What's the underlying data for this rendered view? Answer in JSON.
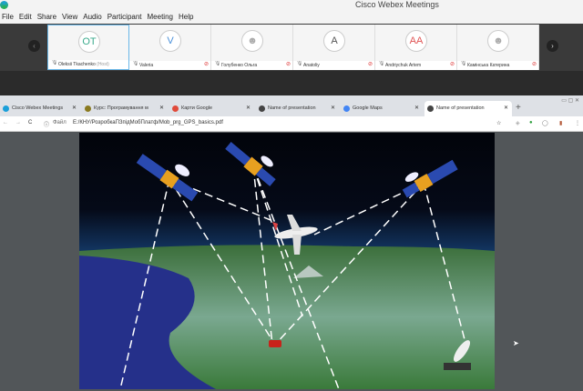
{
  "app": {
    "title": "Cisco Webex Meetings"
  },
  "menu": [
    "File",
    "Edit",
    "Share",
    "View",
    "Audio",
    "Participant",
    "Meeting",
    "Help"
  ],
  "participants": [
    {
      "initials": "OT",
      "name": "Oleksii Tkachenko",
      "role": "(Host)",
      "color": "#3aaa8c",
      "muted": false
    },
    {
      "initials": "V",
      "name": "Valeria",
      "color": "#4a90d9",
      "muted": true
    },
    {
      "initials": "",
      "name": "Голубенко Ольга",
      "color": "#aaa",
      "muted": true
    },
    {
      "initials": "A",
      "name": "Anatoliy",
      "color": "#555",
      "muted": true
    },
    {
      "initials": "AA",
      "name": "Andriychuk Artem",
      "color": "#e05555",
      "muted": true
    },
    {
      "initials": "",
      "name": "Камінська Катерина",
      "color": "#aaa",
      "muted": true
    }
  ],
  "browser": {
    "tabs": [
      {
        "label": "Cisco Webex Meetings",
        "icon_color": "#1a9fd9"
      },
      {
        "label": "Курс: Програмування м",
        "icon_color": "#8a7a20"
      },
      {
        "label": "Карти Google",
        "icon_color": "#e04a3a"
      },
      {
        "label": "Name of presentation",
        "icon_color": "#444"
      },
      {
        "label": "Google Maps",
        "icon_color": "#4285f4"
      },
      {
        "label": "Name of presentation",
        "icon_color": "#444"
      }
    ],
    "new_tab": "+",
    "file_label": "Файл",
    "url": "E:/КНУ/РозробкаПЗпідМобПлатф/Mob_prg_GPS_basics.pdf"
  }
}
